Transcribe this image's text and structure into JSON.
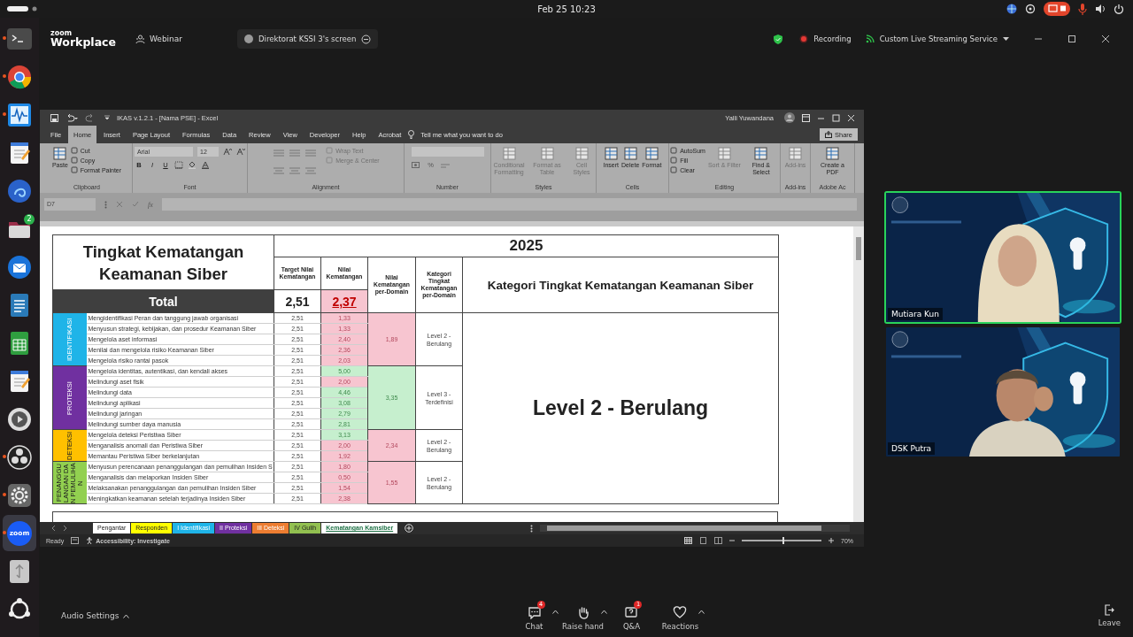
{
  "system_bar": {
    "clock": "Feb 25  10:23"
  },
  "dock": [
    {
      "kind": "terminal",
      "running": true,
      "focused": false
    },
    {
      "kind": "browser",
      "running": true,
      "focused": false
    },
    {
      "kind": "monitor",
      "running": true,
      "focused": false
    },
    {
      "kind": "notes",
      "running": false,
      "focused": false
    },
    {
      "kind": "swirl",
      "running": false,
      "focused": false
    },
    {
      "kind": "folder",
      "running": false,
      "focused": false,
      "badge": "2"
    },
    {
      "kind": "mail",
      "running": false,
      "focused": false
    },
    {
      "kind": "writer",
      "running": false,
      "focused": false
    },
    {
      "kind": "calc",
      "running": false,
      "focused": false
    },
    {
      "kind": "editor",
      "running": false,
      "focused": false
    },
    {
      "kind": "disc",
      "running": false,
      "focused": false
    },
    {
      "kind": "obs",
      "running": true,
      "focused": false
    },
    {
      "kind": "settings",
      "running": true,
      "focused": false
    },
    {
      "kind": "zoom",
      "running": true,
      "focused": true,
      "label": "zoom"
    },
    {
      "kind": "usb",
      "running": false,
      "focused": false
    },
    {
      "kind": "ubuntu",
      "running": false,
      "focused": false
    }
  ],
  "meeting_header": {
    "logo_small": "zoom",
    "logo": "Workplace",
    "mode": "Webinar",
    "share_tab": "Direktorat KSSI 3's screen",
    "recording": "Recording",
    "stream": "Custom Live Streaming Service"
  },
  "excel": {
    "title": "IKAS v.1.2.1 - [Nama PSE] - Excel",
    "user": "Yalli Yuwandana",
    "menu": [
      {
        "label": "File",
        "selected": false
      },
      {
        "label": "Home",
        "selected": true
      },
      {
        "label": "Insert",
        "selected": false
      },
      {
        "label": "Page Layout",
        "selected": false
      },
      {
        "label": "Formulas",
        "selected": false
      },
      {
        "label": "Data",
        "selected": false
      },
      {
        "label": "Review",
        "selected": false
      },
      {
        "label": "View",
        "selected": false
      },
      {
        "label": "Developer",
        "selected": false
      },
      {
        "label": "Help",
        "selected": false
      },
      {
        "label": "Acrobat",
        "selected": false
      }
    ],
    "tell_me": "Tell me what you want to do",
    "share": "Share",
    "ribbon": [
      {
        "label": "Clipboard",
        "items": [
          {
            "kind": "big",
            "label": "Paste",
            "disabled": false
          },
          {
            "kind": "stack",
            "entries": [
              {
                "label": "Cut",
                "disabled": false
              },
              {
                "label": "Copy",
                "disabled": false
              },
              {
                "label": "Format Painter",
                "disabled": false
              }
            ]
          }
        ]
      },
      {
        "label": "Font",
        "items": [
          {
            "kind": "font",
            "name": "Arial",
            "size": "12",
            "marks": [
              "B",
              "I",
              "U"
            ]
          }
        ]
      },
      {
        "label": "Alignment",
        "items": [
          {
            "kind": "align",
            "entries": [
              {
                "label": "Wrap Text",
                "disabled": true
              },
              {
                "label": "Merge & Center",
                "disabled": true
              }
            ]
          }
        ]
      },
      {
        "label": "Number",
        "items": [
          {
            "kind": "number",
            "marks": [
              "%"
            ]
          }
        ]
      },
      {
        "label": "Styles",
        "items": [
          {
            "kind": "big",
            "label": "Conditional Formatting",
            "disabled": true
          },
          {
            "kind": "big",
            "label": "Format as Table",
            "disabled": true
          },
          {
            "kind": "big",
            "label": "Cell Styles",
            "disabled": true
          }
        ]
      },
      {
        "label": "Cells",
        "items": [
          {
            "kind": "big",
            "label": "Insert",
            "disabled": false
          },
          {
            "kind": "big",
            "label": "Delete",
            "disabled": false
          },
          {
            "kind": "big",
            "label": "Format",
            "disabled": false
          }
        ]
      },
      {
        "label": "Editing",
        "items": [
          {
            "kind": "stack",
            "entries": [
              {
                "label": "AutoSum",
                "disabled": false
              },
              {
                "label": "Fill",
                "disabled": false
              },
              {
                "label": "Clear",
                "disabled": false
              }
            ]
          },
          {
            "kind": "big",
            "label": "Sort & Filter",
            "disabled": true
          },
          {
            "kind": "big",
            "label": "Find & Select",
            "disabled": false
          }
        ]
      },
      {
        "label": "Add-ins",
        "items": [
          {
            "kind": "big",
            "label": "Add-ins",
            "disabled": true
          }
        ]
      },
      {
        "label": "Adobe Ac",
        "items": [
          {
            "kind": "big",
            "label": "Create a PDF",
            "disabled": false
          }
        ]
      }
    ],
    "name_box": "D7",
    "function_label": "fx",
    "table": {
      "title": "Tingkat Kematangan Keamanan Siber",
      "year": "2025",
      "headers": [
        "Target Nilai Kematangan",
        "Nilai Kematangan",
        "Nilai Kematangan per-Domain",
        "Kategori Tingkat Kematangan per-Domain",
        "Kategori Tingkat Kematangan Keamanan Siber"
      ],
      "total_label": "Total",
      "total_target": "2,51",
      "total_value": "2,37",
      "total_met": false,
      "overall": "Level 2 - Berulang",
      "domains": [
        {
          "label": "IDENTIFIKASI",
          "color": "#1fb4e8",
          "value": "1,89",
          "met": false,
          "category": "Level 2 - Berulang",
          "rows": [
            {
              "text": "Mengidentifikasi Peran dan tanggung jawab organisasi",
              "target": "2,51",
              "value": "1,33",
              "met": false
            },
            {
              "text": "Menyusun strategi, kebijakan, dan prosedur Keamanan Siber",
              "target": "2,51",
              "value": "1,33",
              "met": false
            },
            {
              "text": "Mengelola aset informasi",
              "target": "2,51",
              "value": "2,40",
              "met": false
            },
            {
              "text": "Menilai dan mengelola risiko Keamanan Siber",
              "target": "2,51",
              "value": "2,36",
              "met": false
            },
            {
              "text": "Mengelola risiko rantai pasok",
              "target": "2,51",
              "value": "2,03",
              "met": false
            }
          ]
        },
        {
          "label": "PROTEKSI",
          "color": "#7030a0",
          "value": "3,35",
          "met": true,
          "category": "Level 3 - Terdefinisi",
          "rows": [
            {
              "text": "Mengelola identitas, autentikasi, dan kendali akses",
              "target": "2,51",
              "value": "5,00",
              "met": true
            },
            {
              "text": "Melindungi aset fisik",
              "target": "2,51",
              "value": "2,00",
              "met": false
            },
            {
              "text": "Melindungi data",
              "target": "2,51",
              "value": "4,46",
              "met": true
            },
            {
              "text": "Melindungi aplikasi",
              "target": "2,51",
              "value": "3,08",
              "met": true
            },
            {
              "text": "Melindungi jaringan",
              "target": "2,51",
              "value": "2,79",
              "met": true
            },
            {
              "text": "Melindungi sumber daya manusia",
              "target": "2,51",
              "value": "2,81",
              "met": true
            }
          ]
        },
        {
          "label": "DETEKSI",
          "color": "#ffc000",
          "value": "2,34",
          "met": false,
          "category": "Level 2 - Berulang",
          "rows": [
            {
              "text": "Mengelola deteksi Peristiwa Siber",
              "target": "2,51",
              "value": "3,13",
              "met": true
            },
            {
              "text": "Menganalisis anomali dan Peristiwa Siber",
              "target": "2,51",
              "value": "2,00",
              "met": false
            },
            {
              "text": "Memantau Peristiwa Siber berkelanjutan",
              "target": "2,51",
              "value": "1,92",
              "met": false
            }
          ]
        },
        {
          "label": "PENANGGULANGAN DAN PEMULIHAN",
          "color": "#92d050",
          "value": "1,55",
          "met": false,
          "category": "Level 2 - Berulang",
          "rows": [
            {
              "text": "Menyusun perencanaan penanggulangan dan pemulihan Insiden S",
              "target": "2,51",
              "value": "1,80",
              "met": false
            },
            {
              "text": "Menganalisis dan melaporkan Insiden Siber",
              "target": "2,51",
              "value": "0,50",
              "met": false
            },
            {
              "text": "Melaksanakan penanggulangan dan pemulihan Insiden Siber",
              "target": "2,51",
              "value": "1,54",
              "met": false
            },
            {
              "text": "Meningkatkan keamanan setelah terjadinya Insiden Siber",
              "target": "2,51",
              "value": "2,38",
              "met": false
            }
          ]
        }
      ]
    },
    "sheet_tabs": [
      {
        "label": "Pengantar",
        "color": "#ffffff",
        "selected": false
      },
      {
        "label": "Responden",
        "color": "#ffff00",
        "selected": false
      },
      {
        "label": "I Identifikasi",
        "color": "#1fb4e8",
        "selected": false
      },
      {
        "label": "II Proteksi",
        "color": "#7030a0",
        "selected": false
      },
      {
        "label": "III Deteksi",
        "color": "#ed7d31",
        "selected": false
      },
      {
        "label": "IV Gulih",
        "color": "#92c050",
        "selected": false
      },
      {
        "label": "Kematangan Kamsiber",
        "color": "#ffffff",
        "selected": true
      }
    ],
    "status": "Ready",
    "accessibility": "Accessibility: Investigate",
    "zoom": {
      "reading": "70%",
      "level": 0.52
    }
  },
  "participants": [
    {
      "name": "Mutiara Kun",
      "speaking": true
    },
    {
      "name": "DSK Putra",
      "speaking": false
    }
  ],
  "toolbar": {
    "audio": "Audio Settings",
    "items": [
      {
        "kind": "chat",
        "label": "Chat",
        "badge": "4",
        "caret": true
      },
      {
        "kind": "hand",
        "label": "Raise hand",
        "caret": true
      },
      {
        "kind": "qa",
        "label": "Q&A",
        "badge": "1",
        "caret": false
      },
      {
        "kind": "reactions",
        "label": "Reactions",
        "caret": true
      }
    ],
    "leave": "Leave"
  }
}
